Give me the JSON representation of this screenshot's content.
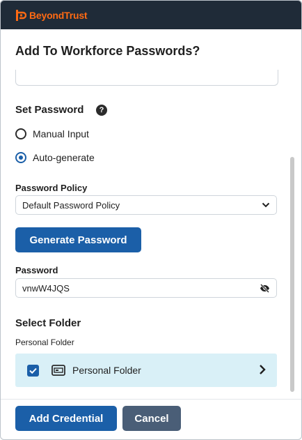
{
  "header": {
    "brand": "BeyondTrust",
    "brand_color": "#ff6a13",
    "bg_color": "#1f2b38"
  },
  "dialog": {
    "title": "Add To Workforce Passwords?"
  },
  "set_password": {
    "heading": "Set Password",
    "help_icon": "question-circle-icon",
    "options": [
      {
        "label": "Manual Input",
        "checked": false
      },
      {
        "label": "Auto-generate",
        "checked": true
      }
    ]
  },
  "policy": {
    "label": "Password Policy",
    "value": "Default Password Policy"
  },
  "generate_button": "Generate Password",
  "password": {
    "label": "Password",
    "value": "vnwW4JQS",
    "toggle_icon": "eye-slash-icon"
  },
  "folder": {
    "heading": "Select Folder",
    "path_label": "Personal Folder",
    "items": [
      {
        "name": "Personal Folder",
        "checked": true,
        "icon": "folder-card-icon"
      }
    ]
  },
  "footer": {
    "add_label": "Add Credential",
    "cancel_label": "Cancel"
  },
  "colors": {
    "primary": "#1b5fa8",
    "secondary": "#4a5e77",
    "selected_row": "#d9f0f7"
  }
}
